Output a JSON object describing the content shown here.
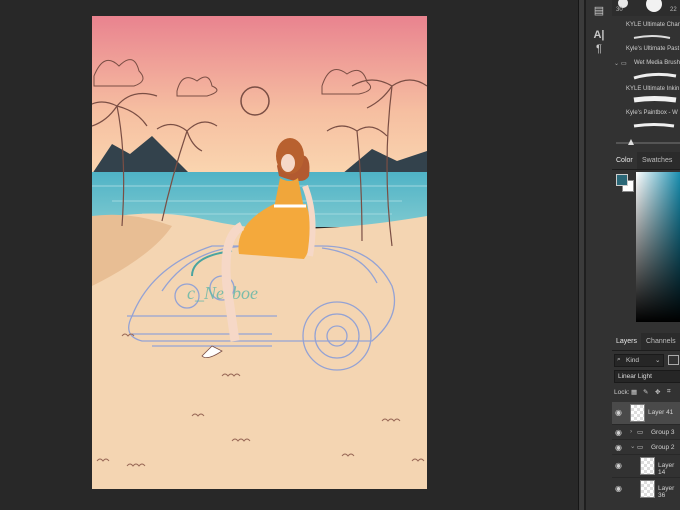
{
  "brushes": {
    "sizes": [
      "30",
      "22"
    ],
    "items": [
      {
        "label": "KYLE Ultimate Char"
      },
      {
        "label": "Kyle's Ultimate Past"
      },
      {
        "label": "Wet Media Brush",
        "is_group": true
      },
      {
        "label": "KYLE Ultimate Inkin"
      },
      {
        "label": "Kyle's Paintbox - W"
      }
    ]
  },
  "color_panel": {
    "tabs": [
      "Color",
      "Swatches"
    ],
    "foreground": "#2a6777",
    "background": "#ffffff"
  },
  "layers_panel": {
    "tabs": [
      "Layers",
      "Channels"
    ],
    "filter_kind": "Kind",
    "blend_mode": "Linear Light",
    "lock_label": "Lock:",
    "layers": [
      {
        "name": "Layer 41",
        "type": "layer",
        "selected": true
      },
      {
        "name": "Group 3",
        "type": "group",
        "collapsed": true
      },
      {
        "name": "Group 2",
        "type": "group",
        "collapsed": false
      },
      {
        "name": "Layer 14",
        "type": "layer"
      },
      {
        "name": "Layer 36",
        "type": "layer"
      }
    ]
  },
  "toolstrip": {
    "icons": [
      "brush-panel-icon",
      "character-panel-icon",
      "paragraph-panel-icon"
    ]
  }
}
